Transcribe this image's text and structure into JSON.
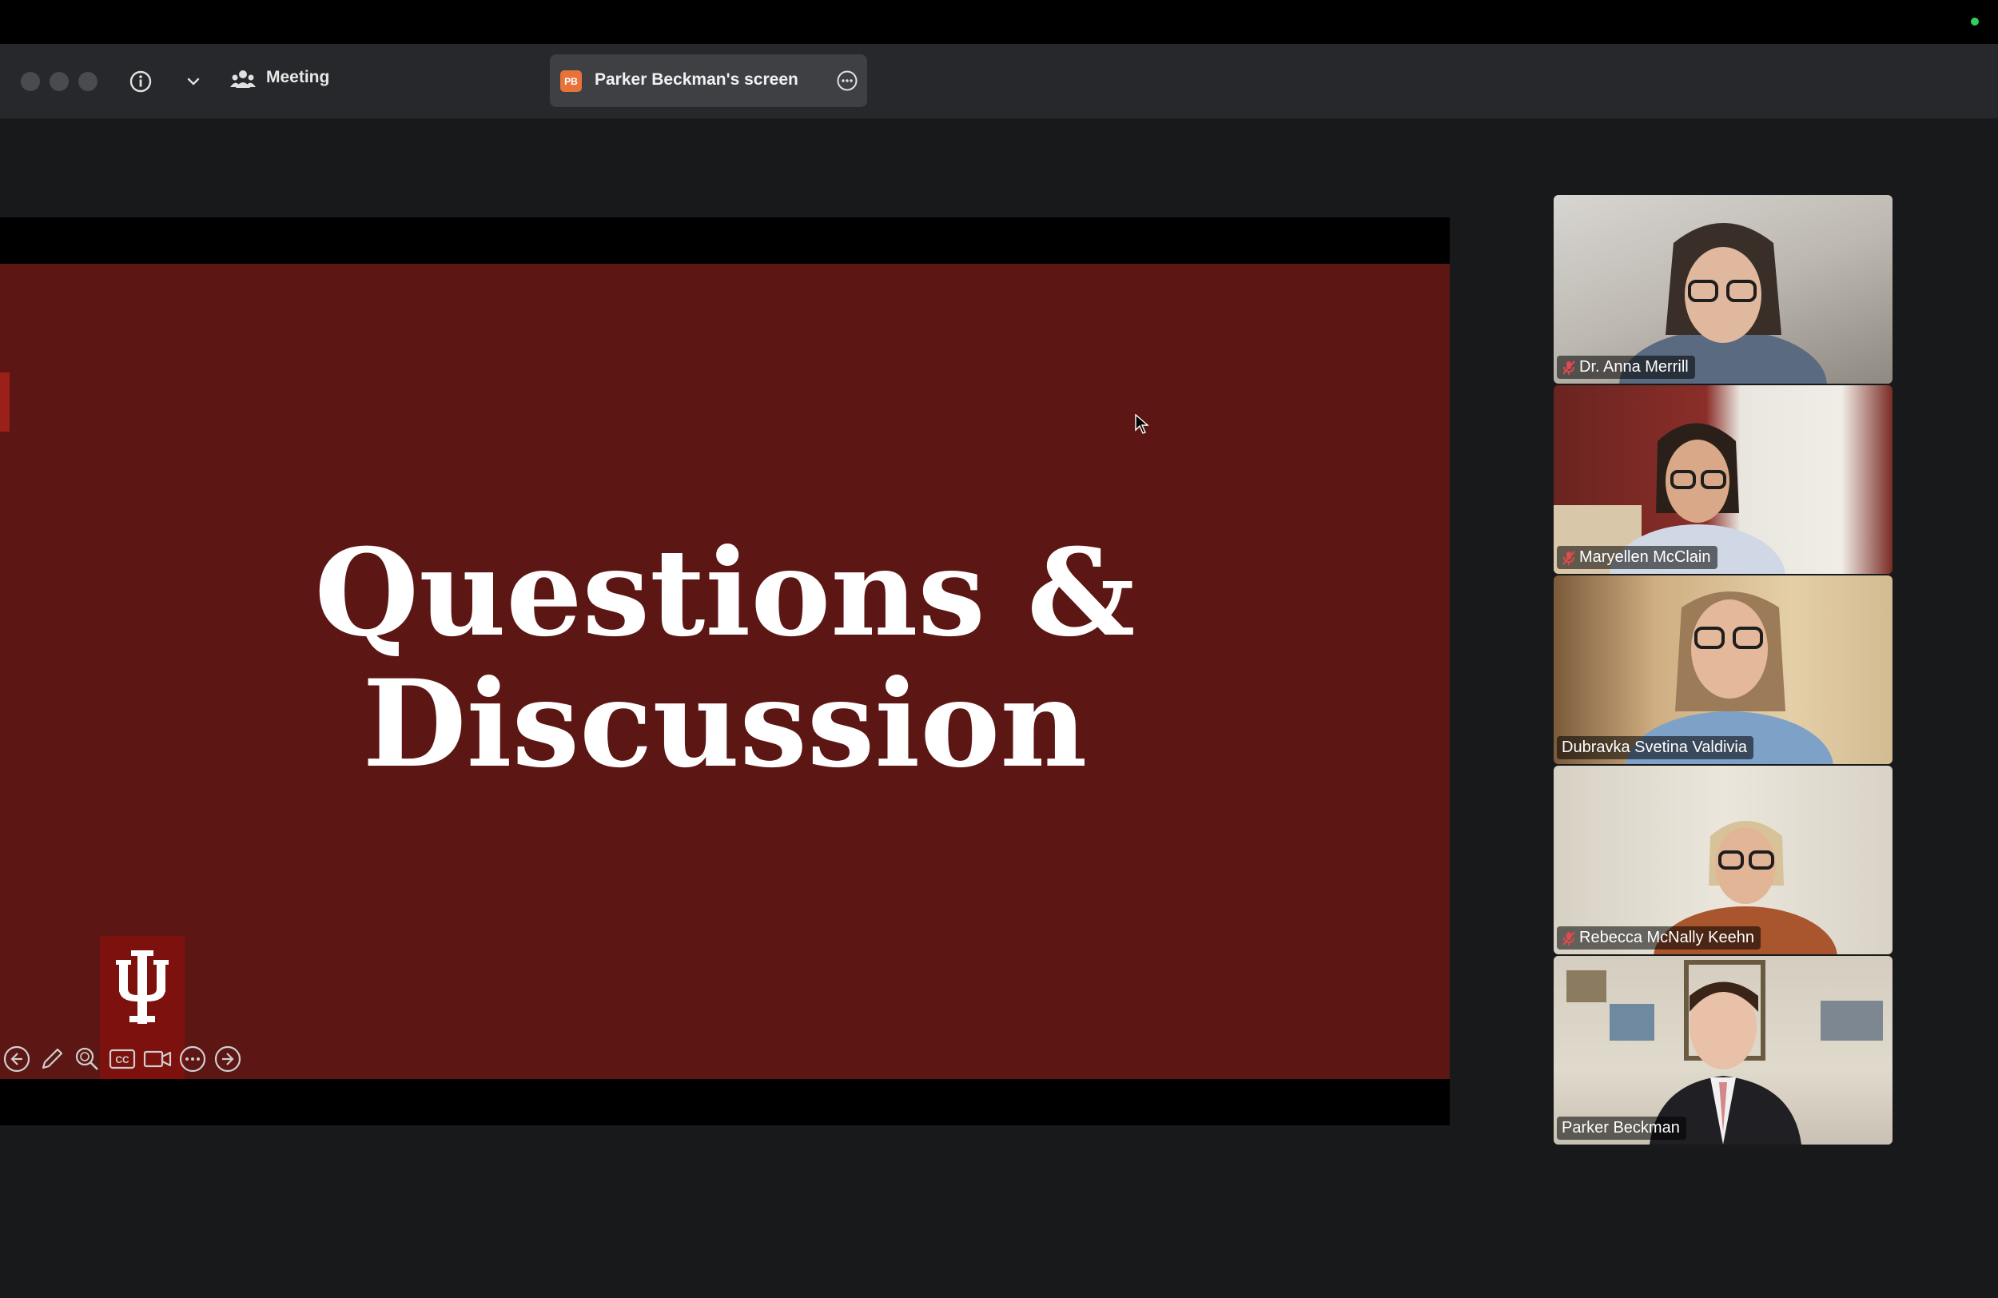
{
  "window": {
    "meeting_label": "Meeting",
    "share": {
      "badge": "PB",
      "label": "Parker Beckman's screen"
    }
  },
  "slide": {
    "title_line1": "Questions &",
    "title_line2": "Discussion",
    "background_color": "#5c1614",
    "logo_color": "#7d110d"
  },
  "slide_controls": [
    "previous-slide",
    "pen",
    "zoom",
    "captions",
    "camera",
    "more",
    "next-slide"
  ],
  "participants": [
    {
      "name": "Dr. Anna Merrill",
      "muted": true,
      "active_speaker": false
    },
    {
      "name": "Maryellen McClain",
      "muted": true,
      "active_speaker": false
    },
    {
      "name": "Dubravka Svetina Valdivia",
      "muted": false,
      "active_speaker": false
    },
    {
      "name": "Rebecca McNally Keehn",
      "muted": true,
      "active_speaker": false
    },
    {
      "name": "Parker Beckman",
      "muted": false,
      "active_speaker": true
    }
  ],
  "colors": {
    "active_speaker_border": "#3bd25a",
    "mute_icon": "#e5484d",
    "share_badge": "#e8733a"
  }
}
